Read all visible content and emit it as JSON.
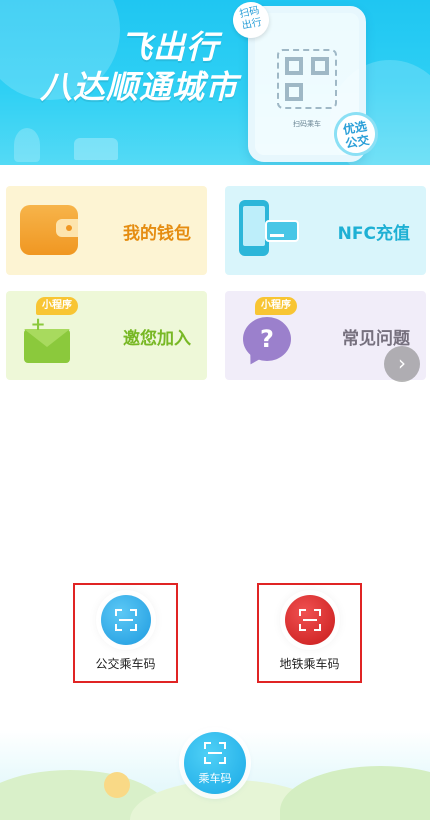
{
  "banner": {
    "slogan_line1": "飞出行",
    "slogan_line2": "八达顺通城市",
    "phone_caption": "扫码乘车",
    "scan_bubble": "扫码\n出行",
    "select_bubble": "优选\n公交"
  },
  "cards": {
    "wallet": {
      "label": "我的钱包",
      "icon": "wallet-icon"
    },
    "nfc": {
      "label": "NFC充值",
      "icon": "nfc-card-icon"
    },
    "invite": {
      "label": "邀您加入",
      "tag": "小程序",
      "icon": "envelope-icon"
    },
    "faq": {
      "label": "常见问题",
      "tag": "小程序",
      "icon": "question-icon"
    }
  },
  "carousel": {
    "next_glyph": "›"
  },
  "ride_codes": {
    "bus": {
      "label": "公交乘车码",
      "color": "#1e9be0"
    },
    "metro": {
      "label": "地铁乘车码",
      "color": "#c81a1a"
    }
  },
  "fab": {
    "label": "乘车码",
    "color": "#1aa9e6"
  },
  "colors": {
    "banner": "#1fc6f2",
    "highlight_border": "#e02424"
  }
}
